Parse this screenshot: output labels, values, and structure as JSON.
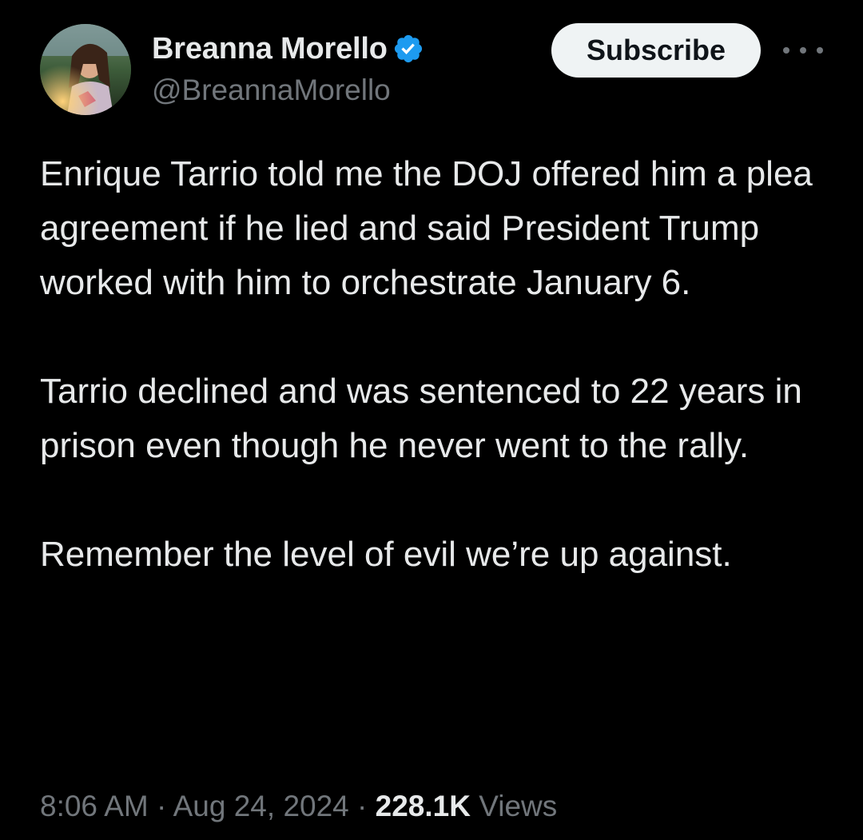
{
  "author": {
    "display_name": "Breanna Morello",
    "handle": "@BreannaMorello",
    "verified_icon": "verified-badge-icon",
    "verified_color": "#1d9bf0"
  },
  "actions": {
    "subscribe_label": "Subscribe",
    "more_icon": "more-options-icon"
  },
  "tweet": {
    "paragraphs": [
      "Enrique Tarrio told me the DOJ offered him a plea agreement if he lied and said President Trump worked with him to orchestrate January 6.",
      "Tarrio declined and was sentenced to 22 years in prison even though he never went to the rally.",
      "Remember the level of evil we’re up against."
    ]
  },
  "meta": {
    "time": "8:06 AM",
    "separator": " · ",
    "date": "Aug 24, 2024",
    "views_count": "228.1K",
    "views_label": "Views"
  },
  "colors": {
    "background": "#000000",
    "primary_text": "#e7e9ea",
    "secondary_text": "#71767b",
    "button_bg": "#eff3f4"
  }
}
